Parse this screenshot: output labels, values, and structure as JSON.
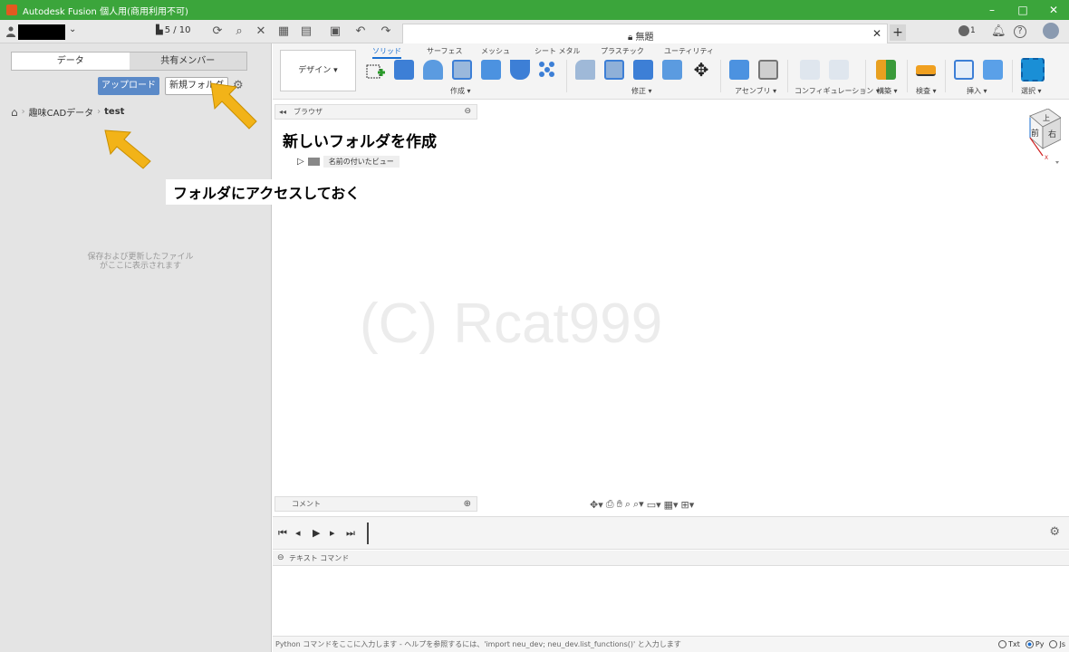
{
  "window": {
    "title": "Autodesk Fusion 個人用(商用利用不可)",
    "controls": [
      "–",
      "□",
      "✕"
    ]
  },
  "topbar": {
    "version": "5 / 10",
    "doc_tab_title": "無題",
    "notif_count": "1"
  },
  "data_panel": {
    "tabs": [
      "データ",
      "共有メンバー"
    ],
    "upload_label": "アップロード",
    "new_folder_label": "新規フォルダ",
    "breadcrumb": [
      "趣味CADデータ",
      "test"
    ],
    "empty_message_line1": "保存および更新したファイル",
    "empty_message_line2": "がここに表示されます"
  },
  "annotations": {
    "create_folder": "新しいフォルダを作成",
    "access_folder": "フォルダにアクセスしておく"
  },
  "ribbon": {
    "workspace": "デザイン ▾",
    "tabs": [
      "ソリッド",
      "サーフェス",
      "メッシュ",
      "シート メタル",
      "プラスチック",
      "ユーティリティ"
    ],
    "groups": [
      "作成 ▾",
      "修正 ▾",
      "アセンブリ ▾",
      "コンフィギュレーション ▾",
      "構築 ▾",
      "検査 ▾",
      "挿入 ▾",
      "選択 ▾"
    ]
  },
  "browser": {
    "title": "ブラウザ",
    "named_views": "名前の付いたビュー"
  },
  "canvas": {
    "watermark": "(C) Rcat999",
    "viewcube_top": "上",
    "viewcube_front": "前",
    "viewcube_right": "右"
  },
  "comment": {
    "title": "コメント"
  },
  "textcmd": {
    "title": "テキスト コマンド",
    "input_placeholder": "Python コマンドをここに入力します - ヘルプを参照するには、'import neu_dev; neu_dev.list_functions()' と入力します",
    "modes": [
      "Txt",
      "Py",
      "Js"
    ],
    "selected_mode": "Py"
  },
  "colors": {
    "title_bar": "#3ba53b",
    "accent": "#1a6fd1",
    "arrow": "#f2b318",
    "upload": "#5b8ac8"
  }
}
